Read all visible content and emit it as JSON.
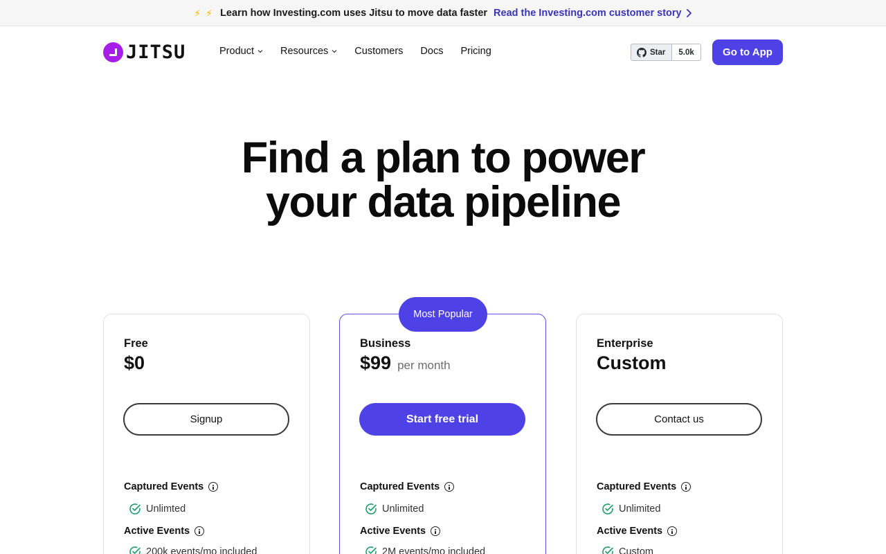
{
  "banner": {
    "text": "Learn how Investing.com uses Jitsu to move data faster",
    "link": "Read the Investing.com customer story"
  },
  "header": {
    "logo_text": "JITSU",
    "nav": [
      {
        "label": "Product",
        "has_dropdown": true
      },
      {
        "label": "Resources",
        "has_dropdown": true
      },
      {
        "label": "Customers",
        "has_dropdown": false
      },
      {
        "label": "Docs",
        "has_dropdown": false
      },
      {
        "label": "Pricing",
        "has_dropdown": false
      }
    ],
    "github": {
      "star_label": "Star",
      "count": "5.0k"
    },
    "cta": "Go to App"
  },
  "hero": {
    "line1": "Find a plan to power",
    "line2": "your data pipeline"
  },
  "plans": [
    {
      "name": "Free",
      "price": "$0",
      "period": "",
      "cta": "Signup",
      "captured_title": "Captured Events",
      "captured_value": "Unlimted",
      "active_title": "Active Events",
      "active_value": "200k events/mo included"
    },
    {
      "name": "Business",
      "price": "$99",
      "period": "per month",
      "badge": "Most Popular",
      "cta": "Start free trial",
      "captured_title": "Captured Events",
      "captured_value": "Unlimited",
      "active_title": "Active Events",
      "active_value": "2M events/mo included"
    },
    {
      "name": "Enterprise",
      "price": "Custom",
      "period": "",
      "cta": "Contact us",
      "captured_title": "Captured Events",
      "captured_value": "Unlimited",
      "active_title": "Active Events",
      "active_value": "Custom"
    }
  ],
  "colors": {
    "accent": "#4e42e6",
    "logo": "#a61fe8",
    "check": "#1f9d6b",
    "banner_link": "#3a34b8"
  },
  "icons": [
    "bolt-icon",
    "chevron-right-icon",
    "chevron-down-icon",
    "github-icon",
    "info-icon",
    "check-circle-icon"
  ]
}
